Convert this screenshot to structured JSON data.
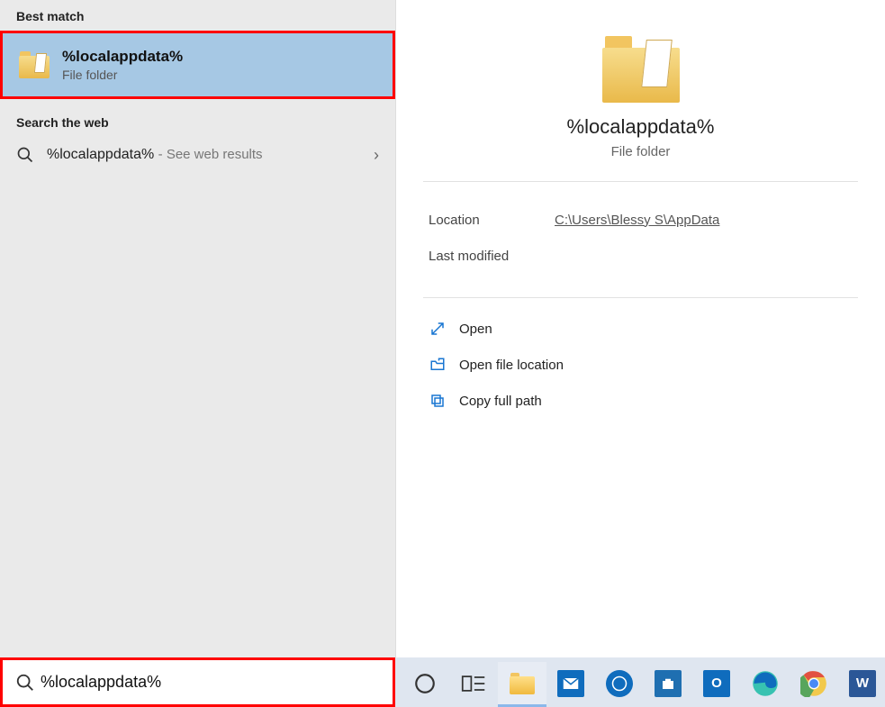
{
  "left": {
    "best_match_header": "Best match",
    "best_match": {
      "title": "%localappdata%",
      "subtitle": "File folder"
    },
    "web_header": "Search the web",
    "web_result": {
      "text": "%localappdata%",
      "hint": "- See web results"
    }
  },
  "detail": {
    "title": "%localappdata%",
    "subtitle": "File folder",
    "location_label": "Location",
    "location_value": "C:\\Users\\Blessy S\\AppData",
    "modified_label": "Last modified",
    "modified_value": "",
    "actions": {
      "open": "Open",
      "open_location": "Open file location",
      "copy_path": "Copy full path"
    }
  },
  "search_input_value": "%localappdata%"
}
